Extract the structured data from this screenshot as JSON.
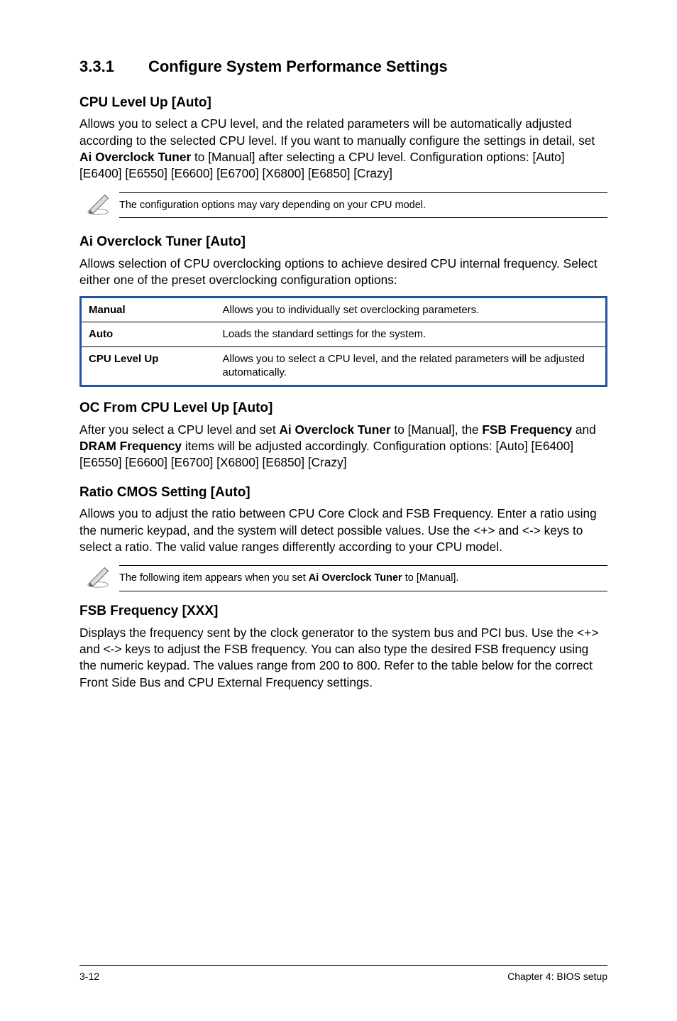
{
  "section": {
    "number": "3.3.1",
    "title": "Configure System Performance Settings"
  },
  "cpu_level_up": {
    "heading": "CPU Level Up [Auto]",
    "body_parts": [
      "Allows you to select a CPU level, and the related parameters will be automatically adjusted according to the selected CPU level. If you want to manually configure the settings in detail, set ",
      "Ai Overclock Tuner",
      " to [Manual] after selecting a CPU level. Configuration options: [Auto] [E6400] [E6550] [E6600] [E6700] [X6800] [E6850] [Crazy]"
    ]
  },
  "note1": {
    "text": "The configuration options may vary depending on your CPU model.",
    "icon_name": "pencil-note-icon"
  },
  "ai_overclock": {
    "heading": "Ai Overclock Tuner [Auto]",
    "body": "Allows selection of CPU overclocking options to achieve desired CPU internal frequency. Select either one of the preset overclocking configuration options:",
    "rows": [
      {
        "key": "Manual",
        "desc": "Allows you to individually set overclocking parameters."
      },
      {
        "key": "Auto",
        "desc": "Loads the standard settings for the system."
      },
      {
        "key": "CPU Level Up",
        "desc": "Allows you to select a CPU level, and the related parameters will be adjusted automatically."
      }
    ]
  },
  "oc_from": {
    "heading": "OC From CPU Level Up [Auto]",
    "body_parts": [
      "After you select a CPU level and set ",
      "Ai Overclock Tuner",
      " to [Manual], the ",
      "FSB Frequency",
      " and ",
      "DRAM Frequency",
      " items will be adjusted accordingly. Configuration options: [Auto] [E6400] [E6550] [E6600] [E6700] [X6800] [E6850] [Crazy]"
    ]
  },
  "ratio_cmos": {
    "heading": "Ratio CMOS Setting [Auto]",
    "body": "Allows you to adjust the ratio between CPU Core Clock and FSB Frequency. Enter a ratio using the numeric keypad, and the system will detect possible values. Use the <+> and <-> keys to select a ratio. The valid value ranges differently according to your CPU model."
  },
  "note2": {
    "text_parts": [
      "The following item appears when you set ",
      "Ai Overclock Tuner",
      " to [Manual]."
    ],
    "icon_name": "pencil-note-icon"
  },
  "fsb_freq": {
    "heading": "FSB Frequency [XXX]",
    "body": "Displays the frequency sent by the clock generator to the system bus and PCI bus. Use the <+> and <-> keys to adjust the FSB frequency. You can also type the desired FSB frequency using the numeric keypad. The values range from 200 to 800. Refer to the table below for the correct Front Side Bus and CPU External Frequency settings."
  },
  "footer": {
    "left": "3-12",
    "right": "Chapter 4: BIOS setup"
  }
}
